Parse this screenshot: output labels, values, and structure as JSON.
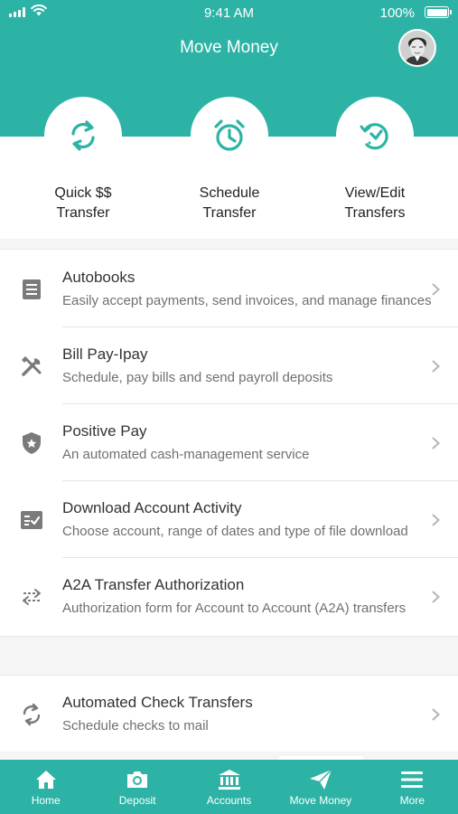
{
  "status_bar": {
    "time": "9:41 AM",
    "battery": "100%"
  },
  "header": {
    "title": "Move Money"
  },
  "quick_actions": [
    {
      "line1": "Quick $$",
      "line2": "Transfer",
      "icon": "refresh-icon"
    },
    {
      "line1": "Schedule",
      "line2": "Transfer",
      "icon": "alarm-clock-icon"
    },
    {
      "line1": "View/Edit",
      "line2": "Transfers",
      "icon": "clock-history-icon"
    }
  ],
  "services": [
    {
      "title": "Autobooks",
      "subtitle": "Easily accept payments, send invoices, and manage finances",
      "icon": "receipt-icon"
    },
    {
      "title": "Bill Pay-Ipay",
      "subtitle": "Schedule, pay bills and send payroll deposits",
      "icon": "tools-icon"
    },
    {
      "title": "Positive Pay",
      "subtitle": "An automated cash-management service",
      "icon": "shield-star-icon"
    },
    {
      "title": "Download Account Activity",
      "subtitle": "Choose account, range of dates and type of file download",
      "icon": "checklist-icon"
    },
    {
      "title": "A2A Transfer Authorization",
      "subtitle": "Authorization form for Account to Account (A2A) transfers",
      "icon": "transfer-arrows-icon"
    }
  ],
  "extra_services": [
    {
      "title": "Automated Check Transfers",
      "subtitle": "Schedule checks to mail",
      "icon": "sync-icon"
    }
  ],
  "tab_bar": [
    {
      "label": "Home",
      "icon": "home-icon"
    },
    {
      "label": "Deposit",
      "icon": "camera-icon"
    },
    {
      "label": "Accounts",
      "icon": "bank-icon"
    },
    {
      "label": "Move Money",
      "icon": "paper-plane-icon",
      "active": true
    },
    {
      "label": "More",
      "icon": "menu-icon"
    }
  ],
  "colors": {
    "brand": "#2db3a6",
    "text": "#333333",
    "subtext": "#707070",
    "icon_gray": "#7a7a7a"
  }
}
